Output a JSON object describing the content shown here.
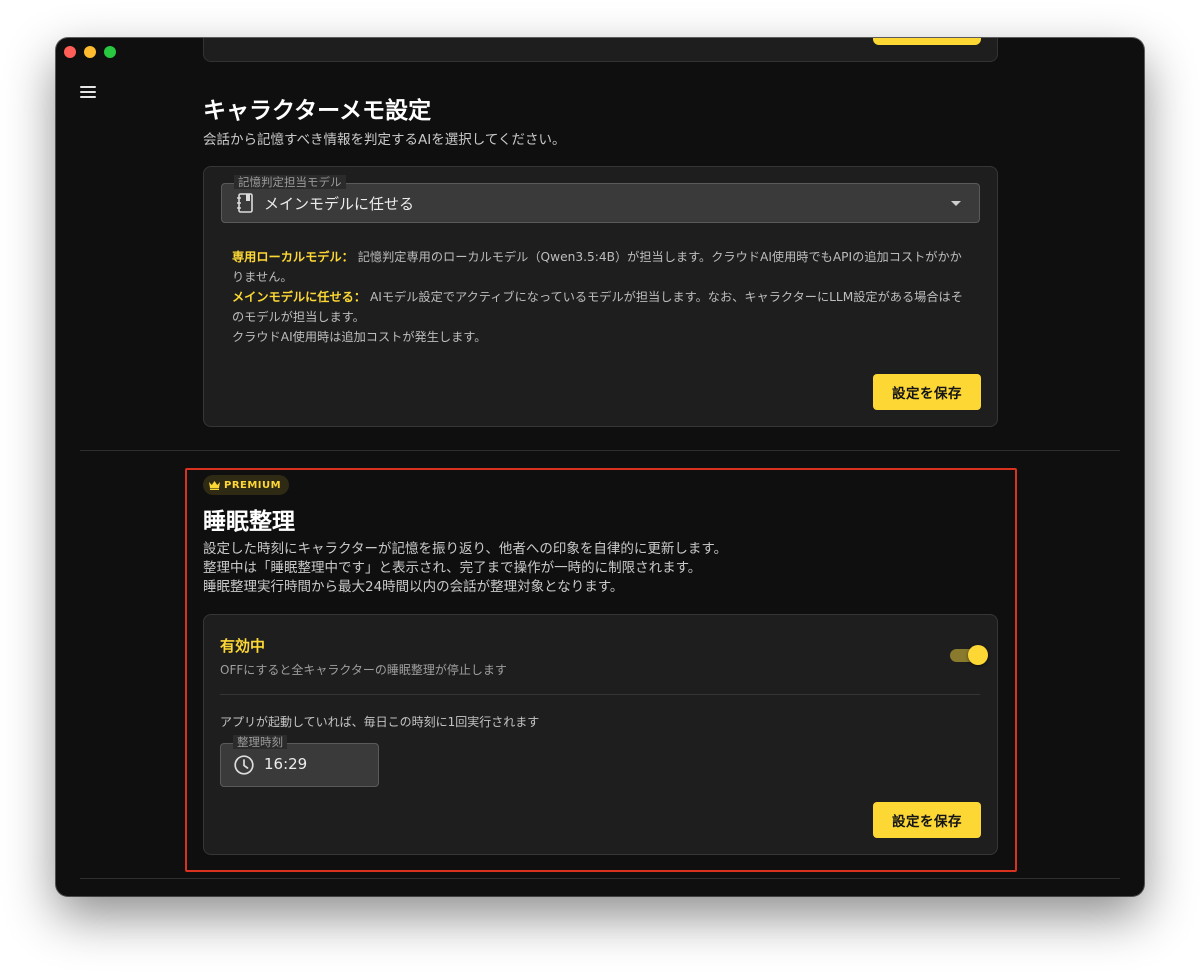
{
  "window": {
    "controls": [
      "close",
      "minimize",
      "maximize"
    ]
  },
  "nav": {
    "menu_icon": "hamburger-menu-icon"
  },
  "top_card": {
    "save_label": ""
  },
  "memo_section": {
    "title": "キャラクターメモ設定",
    "description": "会話から記憶すべき情報を判定するAIを選択してください。",
    "select": {
      "label": "記憶判定担当モデル",
      "value": "メインモデルに任せる",
      "icon": "notebook-icon"
    },
    "info": {
      "local_label": "専用ローカルモデル：",
      "local_text": "記憶判定専用のローカルモデル（Qwen3.5:4B）が担当します。クラウドAI使用時でもAPIの追加コストがかかりません。",
      "main_label": "メインモデルに任せる：",
      "main_text": "AIモデル設定でアクティブになっているモデルが担当します。なお、キャラクターにLLM設定がある場合はそのモデルが担当します。",
      "cloud_note": "クラウドAI使用時は追加コストが発生します。"
    },
    "save_label": "設定を保存"
  },
  "sleep_section": {
    "badge": "PREMIUM",
    "badge_icon": "crown-icon",
    "title": "睡眠整理",
    "desc_line1": "設定した時刻にキャラクターが記憶を振り返り、他者への印象を自律的に更新します。",
    "desc_line2": "整理中は「睡眠整理中です」と表示され、完了まで操作が一時的に制限されます。",
    "desc_line3": "睡眠整理実行時間から最大24時間以内の会話が整理対象となります。",
    "status_title": "有効中",
    "status_sub": "OFFにすると全キャラクターの睡眠整理が停止します",
    "toggle_on": true,
    "run_note": "アプリが起動していれば、毎日この時刻に1回実行されます",
    "time_label": "整理時刻",
    "time_value": "16:29",
    "time_icon": "clock-icon",
    "save_label": "設定を保存"
  },
  "colors": {
    "accent": "#fdd835",
    "background": "#0f0f0f",
    "card": "#1e1e1e",
    "highlight": "#d9321f"
  }
}
